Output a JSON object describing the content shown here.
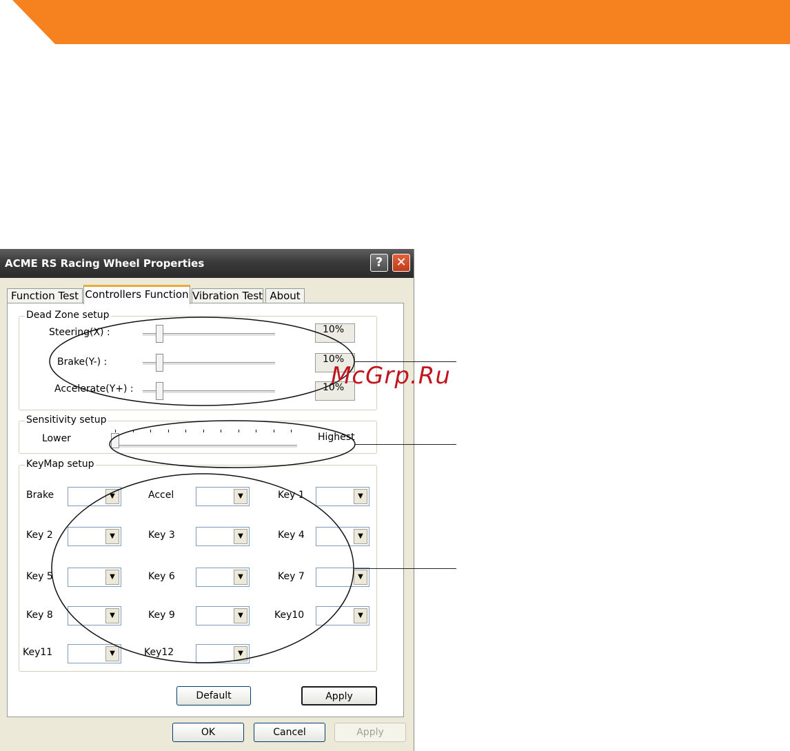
{
  "banner": {
    "color": "#f5821f"
  },
  "watermark": {
    "text": "McGrp.Ru",
    "color": "#c0171f"
  },
  "window": {
    "title": "ACME RS Racing Wheel Properties",
    "help_label": "?",
    "close_label": "✕"
  },
  "tabs": [
    {
      "label": "Function Test",
      "active": false
    },
    {
      "label": "Controllers Function",
      "active": true
    },
    {
      "label": "Vibration Test",
      "active": false
    },
    {
      "label": "About",
      "active": false
    }
  ],
  "dead_zone": {
    "title": "Dead Zone setup",
    "rows": [
      {
        "label": "Steering(X) :",
        "value": "10%",
        "level": 0.1
      },
      {
        "label": "Brake(Y-) :",
        "value": "10%",
        "level": 0.1
      },
      {
        "label": "Accelerate(Y+) :",
        "value": "10%",
        "level": 0.1
      }
    ]
  },
  "sensitivity": {
    "title": "Sensitivity setup",
    "low_label": "Lower",
    "high_label": "Highest",
    "ticks": 11,
    "level": 0
  },
  "keymap": {
    "title": "KeyMap setup",
    "items": [
      {
        "label": "Brake",
        "value": ""
      },
      {
        "label": "Accel",
        "value": ""
      },
      {
        "label": "Key 1",
        "value": ""
      },
      {
        "label": "Key 2",
        "value": ""
      },
      {
        "label": "Key 3",
        "value": ""
      },
      {
        "label": "Key 4",
        "value": ""
      },
      {
        "label": "Key 5",
        "value": ""
      },
      {
        "label": "Key 6",
        "value": ""
      },
      {
        "label": "Key 7",
        "value": ""
      },
      {
        "label": "Key 8",
        "value": ""
      },
      {
        "label": "Key 9",
        "value": ""
      },
      {
        "label": "Key10",
        "value": ""
      },
      {
        "label": "Key11",
        "value": ""
      },
      {
        "label": "Key12",
        "value": ""
      }
    ]
  },
  "panel_buttons": {
    "default_label": "Default",
    "apply_label": "Apply"
  },
  "dialog_buttons": {
    "ok_label": "OK",
    "cancel_label": "Cancel",
    "apply_label": "Apply"
  }
}
